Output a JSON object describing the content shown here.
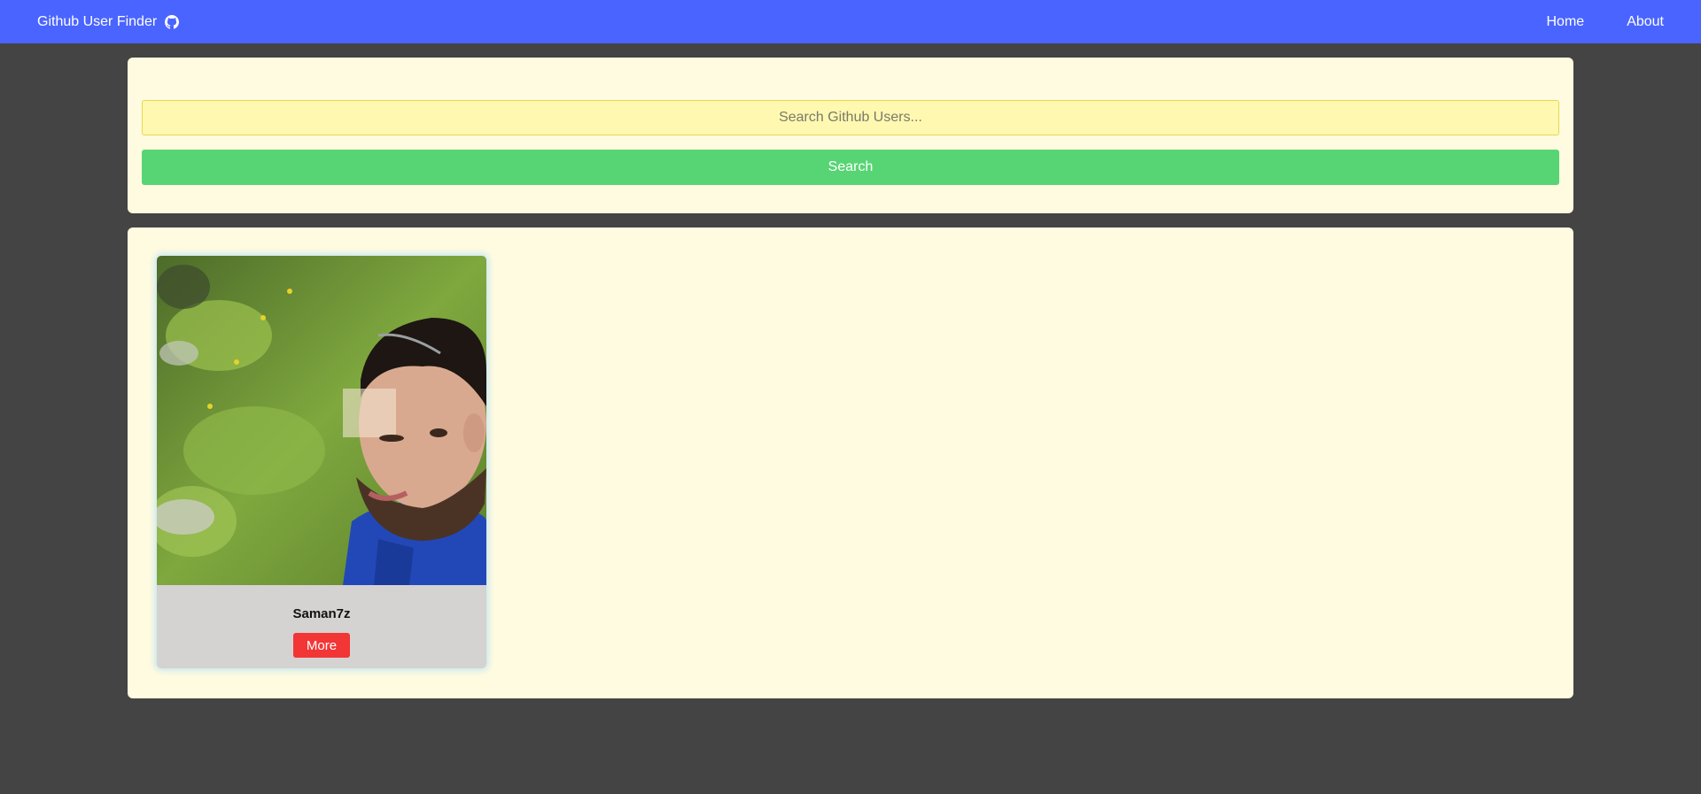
{
  "navbar": {
    "brand": "Github User Finder",
    "brand_icon": "github-icon",
    "links": [
      {
        "label": "Home"
      },
      {
        "label": "About"
      }
    ],
    "color": "#4a64ff"
  },
  "search": {
    "placeholder": "Search Github Users...",
    "value": "",
    "button_label": "Search",
    "button_color": "#57d574"
  },
  "results": {
    "users": [
      {
        "login": "Saman7z",
        "avatar_icon": "avatar-photo",
        "more_label": "More"
      }
    ]
  }
}
